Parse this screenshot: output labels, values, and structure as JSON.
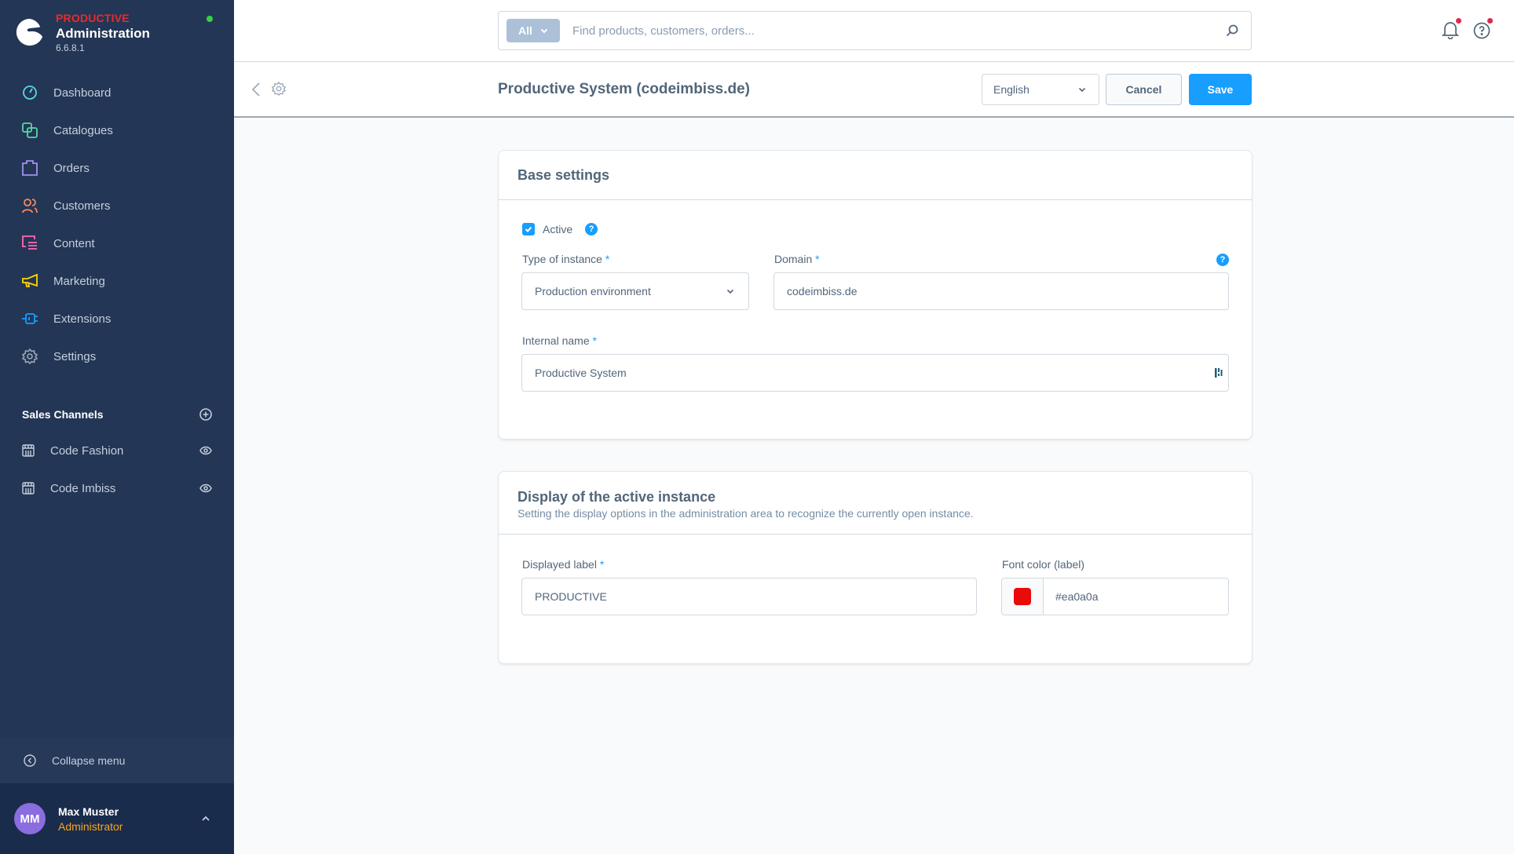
{
  "brand": {
    "environment": "PRODUCTIVE",
    "environment_color": "#ea2a2a",
    "title": "Administration",
    "version": "6.6.8.1",
    "status": "online"
  },
  "sidebar": {
    "items": [
      {
        "label": "Dashboard",
        "icon": "dashboard-icon",
        "color": "#57d9e8"
      },
      {
        "label": "Catalogues",
        "icon": "catalogue-icon",
        "color": "#57d9a3"
      },
      {
        "label": "Orders",
        "icon": "orders-icon",
        "color": "#a092f0"
      },
      {
        "label": "Customers",
        "icon": "customers-icon",
        "color": "#f88962"
      },
      {
        "label": "Content",
        "icon": "content-icon",
        "color": "#ff68b4"
      },
      {
        "label": "Marketing",
        "icon": "marketing-icon",
        "color": "#ffd700"
      },
      {
        "label": "Extensions",
        "icon": "extensions-icon",
        "color": "#189eff"
      },
      {
        "label": "Settings",
        "icon": "settings-icon",
        "color": "#9aa8b5"
      }
    ],
    "sales_channels_title": "Sales Channels",
    "sales_channels": [
      {
        "label": "Code Fashion"
      },
      {
        "label": "Code Imbiss"
      }
    ],
    "collapse_label": "Collapse menu",
    "user": {
      "initials": "MM",
      "name": "Max Muster",
      "role": "Administrator"
    }
  },
  "search": {
    "type_label": "All",
    "placeholder": "Find products, customers, orders..."
  },
  "smartbar": {
    "title": "Productive System (codeimbiss.de)",
    "language": "English",
    "cancel_label": "Cancel",
    "save_label": "Save"
  },
  "base_settings": {
    "title": "Base settings",
    "active_label": "Active",
    "active_checked": true,
    "type_label": "Type of instance",
    "type_value": "Production environment",
    "domain_label": "Domain",
    "domain_value": "codeimbiss.de",
    "internal_name_label": "Internal name",
    "internal_name_value": "Productive System",
    "required_mark": "*",
    "help_glyph": "?"
  },
  "display_settings": {
    "title": "Display of the active instance",
    "subtitle": "Setting the display options in the administration area to recognize the currently open instance.",
    "label_label": "Displayed label",
    "label_value": "PRODUCTIVE",
    "color_label": "Font color (label)",
    "color_value": "#ea0a0a",
    "required_mark": "*"
  }
}
